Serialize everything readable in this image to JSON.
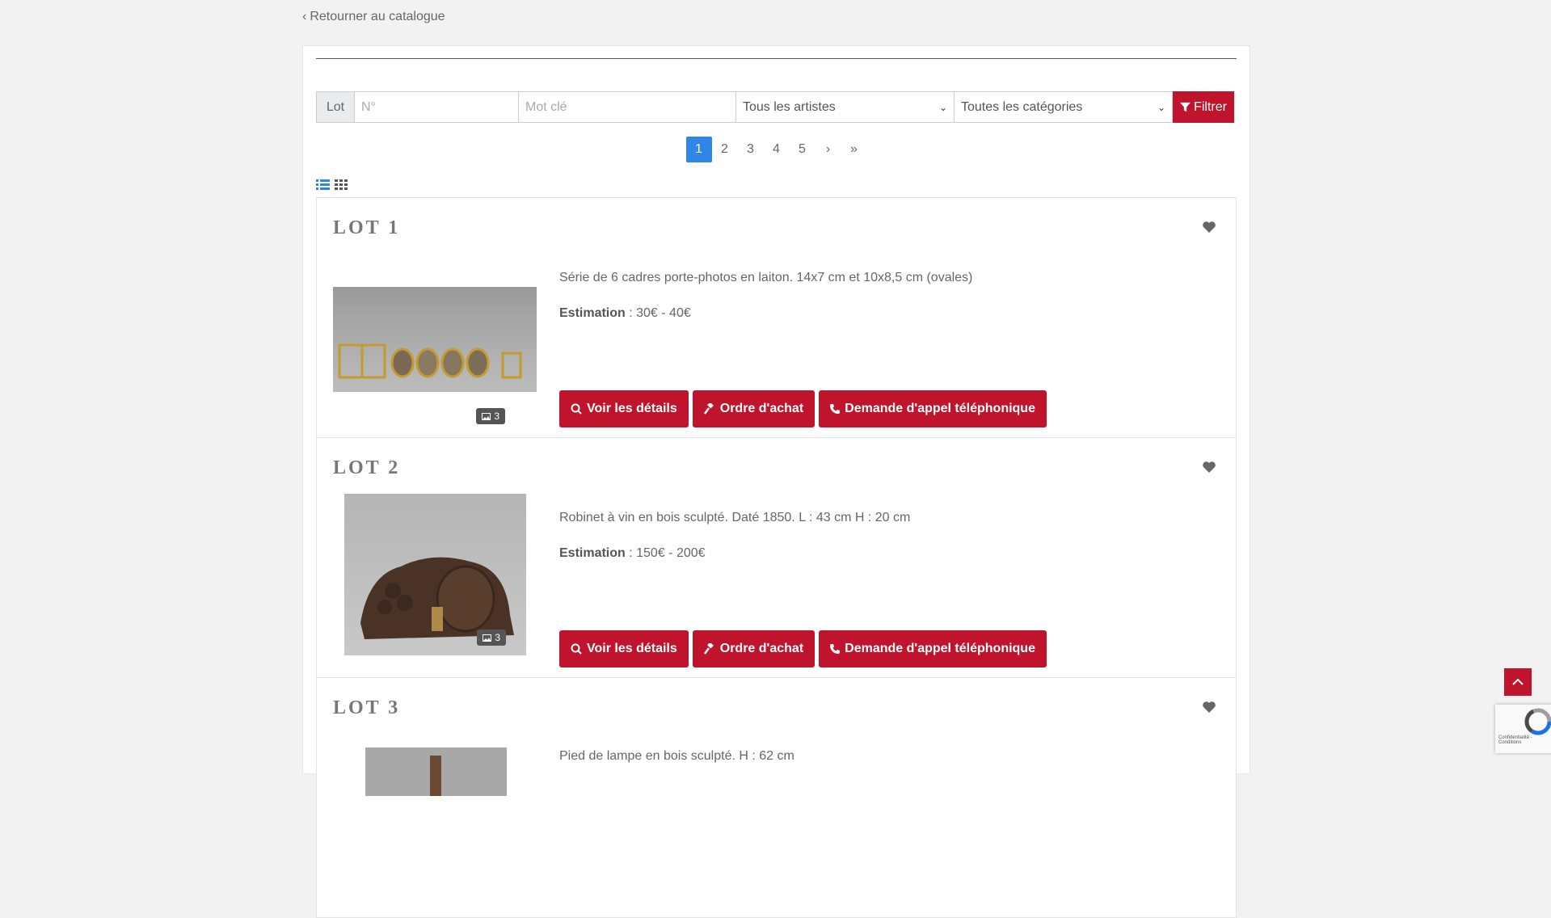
{
  "back_link": "Retourner au catalogue",
  "filters": {
    "lot_label": "Lot",
    "lot_placeholder": "N°",
    "keyword_placeholder": "Mot clé",
    "artist_select": "Tous les artistes",
    "category_select": "Toutes les catégories",
    "filter_button": "Filtrer"
  },
  "pagination": {
    "pages": [
      "1",
      "2",
      "3",
      "4",
      "5"
    ],
    "next": "›",
    "last": "»",
    "current": "1"
  },
  "lots": [
    {
      "title": "LOT 1",
      "description": "Série de 6 cadres porte-photos en laiton. 14x7 cm et 10x8,5 cm (ovales)",
      "estimation_label": "Estimation",
      "estimation_value": " : 30€ - 40€",
      "photo_count": "3"
    },
    {
      "title": "LOT 2",
      "description": "Robinet à vin en bois sculpté. Daté 1850. L : 43 cm H : 20 cm",
      "estimation_label": "Estimation",
      "estimation_value": " : 150€ - 200€",
      "photo_count": "3"
    },
    {
      "title": "LOT 3",
      "description": "Pied de lampe en bois sculpté. H : 62 cm"
    }
  ],
  "buttons": {
    "details": "Voir les détails",
    "order": "Ordre d'achat",
    "phone": "Demande d'appel téléphonique"
  },
  "recaptcha": {
    "text": "Confidentialité - Conditions"
  },
  "colors": {
    "accent": "#c0142c",
    "pagination_active": "#2f86e6"
  }
}
